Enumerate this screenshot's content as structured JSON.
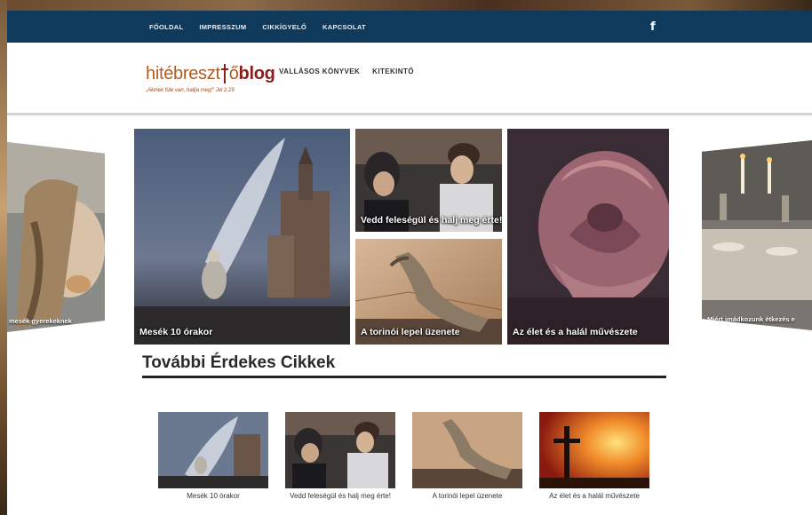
{
  "topnav": {
    "items": [
      {
        "label": "FŐOLDAL"
      },
      {
        "label": "IMPRESSZUM"
      },
      {
        "label": "CIKKÍGYELŐ"
      },
      {
        "label": "KAPCSOLAT"
      }
    ],
    "social_icon": "facebook-icon",
    "social_glyph": "f"
  },
  "logo": {
    "part1": "hitébreszt",
    "part2": "ő",
    "part3": "blog",
    "tagline": "„Akinek füle van, hallja meg!” Jel 2,29"
  },
  "mainnav": {
    "items": [
      {
        "label": "VALLÁSOS KÖNYVEK"
      },
      {
        "label": "KITEKINTŐ"
      }
    ]
  },
  "slider": {
    "left_caption": "mesék gyerekeknek",
    "right_caption": "Miért imádkozunk étkezés e",
    "tiles": [
      {
        "caption": "Mesék 10 órakor"
      },
      {
        "caption": "Vedd feleségül és halj meg érte!"
      },
      {
        "caption": "A torinói lepel üzenete"
      },
      {
        "caption": "Az élet és a halál művészete"
      }
    ]
  },
  "related": {
    "title": "További Érdekes Cikkek",
    "items": [
      {
        "caption": "Mesék 10 órakor"
      },
      {
        "caption": "Vedd feleségül és halj meg érte!"
      },
      {
        "caption": "A torinói lepel üzenete"
      },
      {
        "caption": "Az élet és a halál művészete"
      }
    ]
  },
  "colors": {
    "topbar": "#0f3a5c",
    "logo_orange": "#b55a1e",
    "logo_red": "#8a1c1c"
  }
}
